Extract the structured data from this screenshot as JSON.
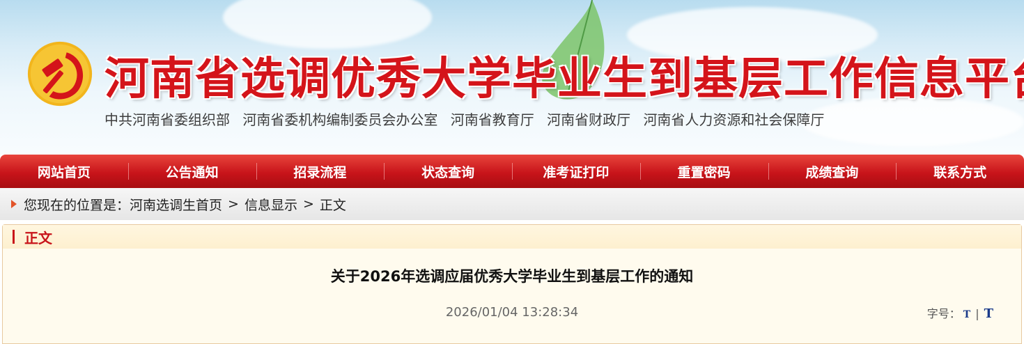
{
  "header": {
    "title": "河南省选调优秀大学毕业生到基层工作信息平台",
    "subtitle_orgs": [
      "中共河南省委组织部",
      "河南省委机构编制委员会办公室",
      "河南省教育厅",
      "河南省财政厅",
      "河南省人力资源和社会保障厅"
    ],
    "emblem_icon": "party-emblem-icon"
  },
  "nav": {
    "items": [
      "网站首页",
      "公告通知",
      "招录流程",
      "状态查询",
      "准考证打印",
      "重置密码",
      "成绩查询",
      "联系方式"
    ]
  },
  "breadcrumb": {
    "prefix": "您现在的位置是：",
    "items": [
      "河南选调生首页",
      "信息显示",
      "正文"
    ],
    "separator": ">"
  },
  "content": {
    "section_label": "正文",
    "article_title": "关于2026年选调应届优秀大学毕业生到基层工作的通知",
    "date": "2026/01/04 13:28:34",
    "font_size_label": "字号：",
    "font_small": "T",
    "font_divider": "|",
    "font_large": "T"
  },
  "colors": {
    "brand_red": "#c8141a",
    "panel_bg": "#fffbee"
  }
}
